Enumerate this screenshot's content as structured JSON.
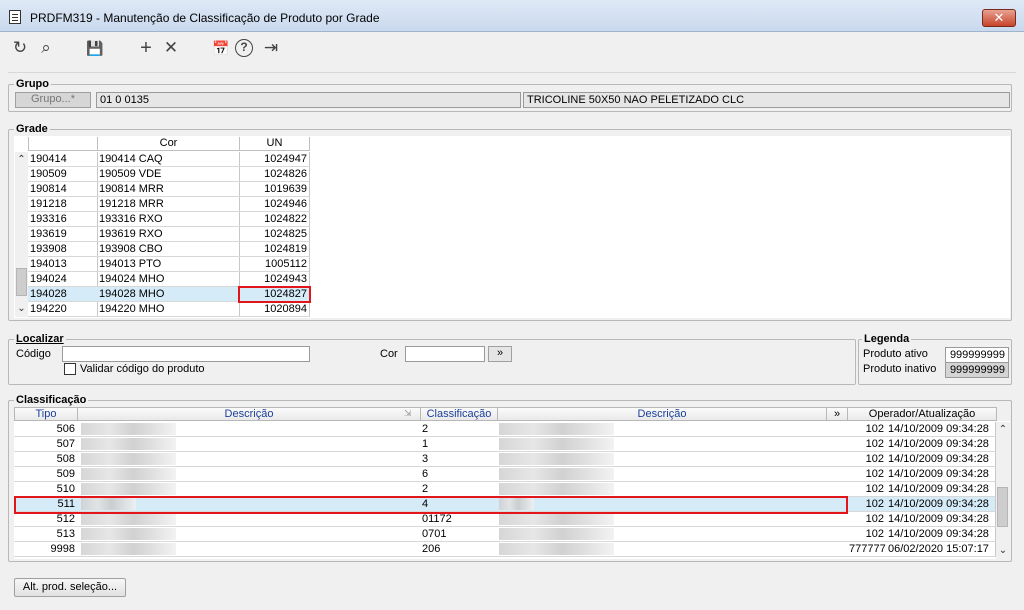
{
  "window": {
    "title": "PRDFM319 - Manutenção de Classificação de Produto por Grade",
    "close": "✕"
  },
  "toolbar": {
    "refresh": "↻",
    "search": "⌕",
    "save": "💾",
    "add": "+",
    "delete": "✕",
    "calendar": "📅",
    "help": "?",
    "exit": "⇥"
  },
  "grupo": {
    "title": "Grupo",
    "button_label": "Grupo...*",
    "code": "01 0 0135",
    "description": "TRICOLINE 50X50 NAO PELETIZADO CLC"
  },
  "grade": {
    "title": "Grade",
    "headers": {
      "cor": "Cor",
      "un": "UN"
    },
    "rows": [
      {
        "code": "190414",
        "cor": "190414 CAQ",
        "un": "1024947"
      },
      {
        "code": "190509",
        "cor": "190509 VDE",
        "un": "1024826"
      },
      {
        "code": "190814",
        "cor": "190814 MRR",
        "un": "1019639"
      },
      {
        "code": "191218",
        "cor": "191218 MRR",
        "un": "1024946"
      },
      {
        "code": "193316",
        "cor": "193316 RXO",
        "un": "1024822"
      },
      {
        "code": "193619",
        "cor": "193619 RXO",
        "un": "1024825"
      },
      {
        "code": "193908",
        "cor": "193908 CBO",
        "un": "1024819"
      },
      {
        "code": "194013",
        "cor": "194013 PTO",
        "un": "1005112"
      },
      {
        "code": "194024",
        "cor": "194024 MHO",
        "un": "1024943"
      },
      {
        "code": "194028",
        "cor": "194028 MHO",
        "un": "1024827"
      },
      {
        "code": "194220",
        "cor": "194220 MHO",
        "un": "1020894"
      }
    ],
    "selected_index": 9
  },
  "localizar": {
    "title": "Localizar",
    "codigo_label": "Código",
    "codigo_value": "",
    "validar_label": "Validar código do produto",
    "cor_label": "Cor",
    "cor_value": "",
    "go_button": "»"
  },
  "legenda": {
    "title": "Legenda",
    "ativo_label": "Produto ativo",
    "ativo_value": "999999999",
    "inativo_label": "Produto inativo",
    "inativo_value": "999999999"
  },
  "classificacao": {
    "title": "Classificação",
    "headers": {
      "tipo": "Tipo",
      "descricao1": "Descrição",
      "classificacao": "Classificação",
      "descricao2": "Descrição",
      "expand": "»",
      "operador": "Operador/Atualização"
    },
    "rows": [
      {
        "tipo": "506",
        "classificacao": "2",
        "operador": "102",
        "data": "14/10/2009 09:34:28"
      },
      {
        "tipo": "507",
        "classificacao": "1",
        "operador": "102",
        "data": "14/10/2009 09:34:28"
      },
      {
        "tipo": "508",
        "classificacao": "3",
        "operador": "102",
        "data": "14/10/2009 09:34:28"
      },
      {
        "tipo": "509",
        "classificacao": "6",
        "operador": "102",
        "data": "14/10/2009 09:34:28"
      },
      {
        "tipo": "510",
        "classificacao": "2",
        "operador": "102",
        "data": "14/10/2009 09:34:28"
      },
      {
        "tipo": "511",
        "classificacao": "4",
        "operador": "102",
        "data": "14/10/2009 09:34:28"
      },
      {
        "tipo": "512",
        "classificacao": "01172",
        "operador": "102",
        "data": "14/10/2009 09:34:28"
      },
      {
        "tipo": "513",
        "classificacao": "0701",
        "operador": "102",
        "data": "14/10/2009 09:34:28"
      },
      {
        "tipo": "9998",
        "classificacao": "206",
        "operador": "777777",
        "data": "06/02/2020 15:07:17"
      }
    ],
    "selected_index": 5
  },
  "footer": {
    "alt_button": "Alt. prod. seleção..."
  },
  "colors": {
    "selection": "#d5ebf7",
    "highlight_border": "#e0161b",
    "header_text": "#1a3f9a"
  }
}
